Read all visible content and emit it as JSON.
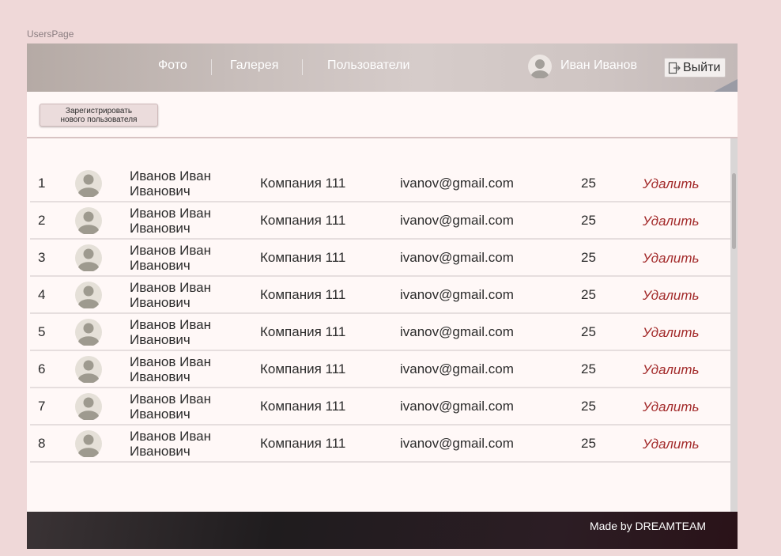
{
  "frame_label": "UsersPage",
  "header": {
    "nav": [
      {
        "label": "Фото"
      },
      {
        "label": "Галерея"
      },
      {
        "label": "Пользователи"
      }
    ],
    "user_name": "Иван Иванов",
    "logout_label": "Выйти"
  },
  "toolbar": {
    "register_line1": "Зарегистрировать",
    "register_line2": "нового пользователя"
  },
  "users": [
    {
      "num": "1",
      "name_line1": "Иванов Иван",
      "name_line2": "Иванович",
      "company": "Компания 111",
      "email": "ivanov@gmail.com",
      "age": "25",
      "delete": "Удалить"
    },
    {
      "num": "2",
      "name_line1": "Иванов Иван",
      "name_line2": "Иванович",
      "company": "Компания 111",
      "email": "ivanov@gmail.com",
      "age": "25",
      "delete": "Удалить"
    },
    {
      "num": "3",
      "name_line1": "Иванов Иван",
      "name_line2": "Иванович",
      "company": "Компания 111",
      "email": "ivanov@gmail.com",
      "age": "25",
      "delete": "Удалить"
    },
    {
      "num": "4",
      "name_line1": "Иванов Иван",
      "name_line2": "Иванович",
      "company": "Компания 111",
      "email": "ivanov@gmail.com",
      "age": "25",
      "delete": "Удалить"
    },
    {
      "num": "5",
      "name_line1": "Иванов Иван",
      "name_line2": "Иванович",
      "company": "Компания 111",
      "email": "ivanov@gmail.com",
      "age": "25",
      "delete": "Удалить"
    },
    {
      "num": "6",
      "name_line1": "Иванов Иван",
      "name_line2": "Иванович",
      "company": "Компания 111",
      "email": "ivanov@gmail.com",
      "age": "25",
      "delete": "Удалить"
    },
    {
      "num": "7",
      "name_line1": "Иванов Иван",
      "name_line2": "Иванович",
      "company": "Компания 111",
      "email": "ivanov@gmail.com",
      "age": "25",
      "delete": "Удалить"
    },
    {
      "num": "8",
      "name_line1": "Иванов Иван",
      "name_line2": "Иванович",
      "company": "Компания 111",
      "email": "ivanov@gmail.com",
      "age": "25",
      "delete": "Удалить"
    }
  ],
  "footer": {
    "text": "Made by DREAMTEAM"
  },
  "colors": {
    "background": "#efd8d8",
    "delete_link": "#a32b2b",
    "footer": "#1f1c1e"
  }
}
